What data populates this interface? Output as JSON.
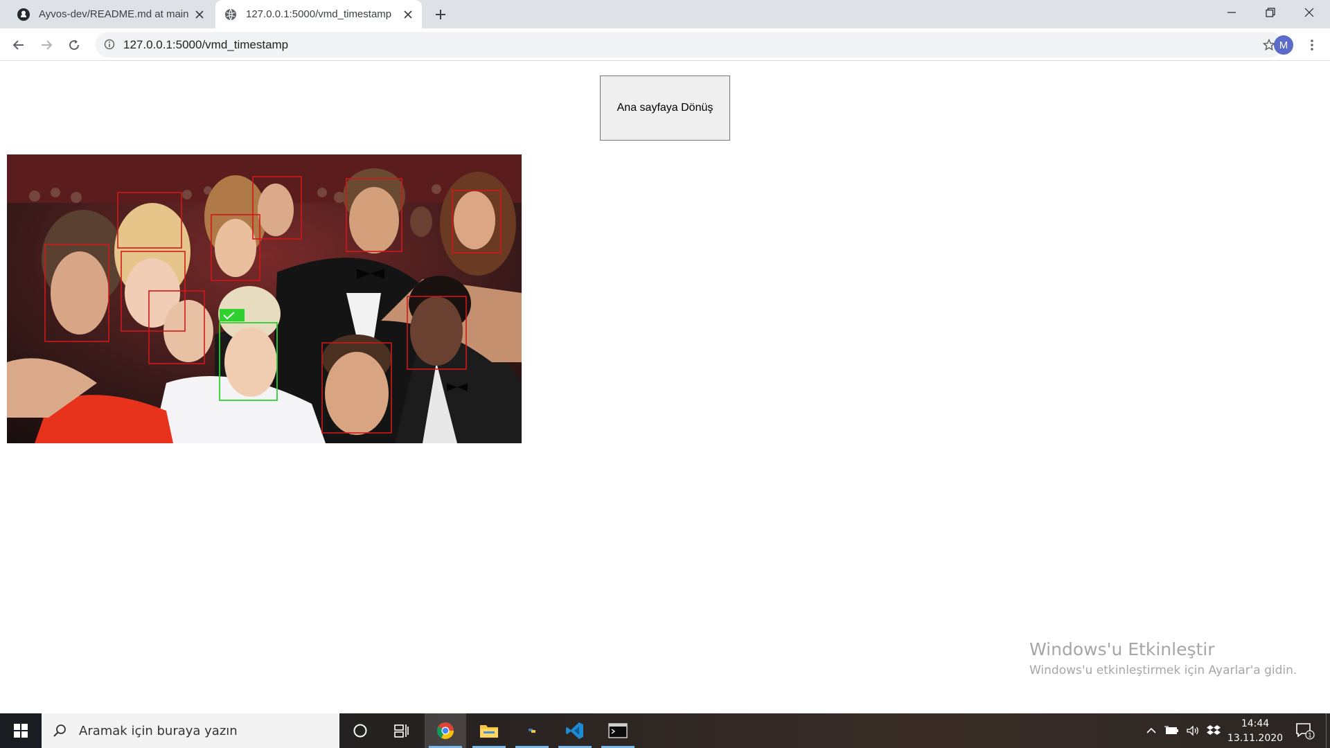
{
  "browser": {
    "tabs": [
      {
        "title": "Ayvos-dev/README.md at main",
        "icon": "github-icon",
        "active": false
      },
      {
        "title": "127.0.0.1:5000/vmd_timestamp",
        "icon": "globe-icon",
        "active": true
      }
    ],
    "url": "127.0.0.1:5000/vmd_timestamp",
    "avatar_letter": "M"
  },
  "page": {
    "back_button_label": "Ana sayfaya Dönüş"
  },
  "photo": {
    "faces": [
      {
        "status": "red"
      },
      {
        "status": "red"
      },
      {
        "status": "red"
      },
      {
        "status": "red"
      },
      {
        "status": "red"
      },
      {
        "status": "red"
      },
      {
        "status": "red"
      },
      {
        "status": "red"
      },
      {
        "status": "red"
      },
      {
        "status": "red"
      },
      {
        "status": "green",
        "tag": "✓"
      }
    ]
  },
  "watermark": {
    "title": "Windows'u Etkinleştir",
    "subtitle": "Windows'u etkinleştirmek için Ayarlar'a gidin."
  },
  "taskbar": {
    "search_placeholder": "Aramak için buraya yazın",
    "time": "14:44",
    "date": "13.11.2020",
    "notification_count": "1"
  },
  "colors": {
    "detect_red": "#d01818",
    "detect_green": "#2ed12e",
    "tabstrip": "#dee1e6",
    "avatar": "#5b6bc9"
  }
}
